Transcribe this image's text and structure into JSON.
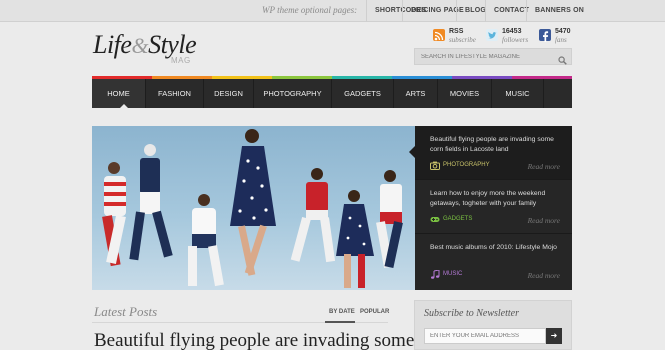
{
  "topbar": {
    "tagline": "WP theme optional pages:",
    "links": [
      "SHORTCODES",
      "PRICING PAGE",
      "BLOG",
      "CONTACT",
      "BANNERS ON"
    ]
  },
  "logo": {
    "line1": "Life",
    "amp": "&",
    "line2": "Style",
    "sub": "MAG"
  },
  "social": [
    {
      "icon": "rss-icon",
      "count": "RSS",
      "label": "subscribe",
      "color": "#f08a24"
    },
    {
      "icon": "twitter-icon",
      "count": "16453",
      "label": "followers",
      "color": "#5bb4dc"
    },
    {
      "icon": "facebook-icon",
      "count": "5470",
      "label": "fans",
      "color": "#3b5998"
    }
  ],
  "search": {
    "placeholder": "SEARCH IN LIFESTYLE MAGAZINE"
  },
  "nav": {
    "items": [
      "HOME",
      "FASHION",
      "DESIGN",
      "PHOTOGRAPHY",
      "GADGETS",
      "ARTS",
      "MOVIES",
      "MUSIC"
    ],
    "active": "HOME",
    "stripe_colors": [
      "#e22b2b",
      "#f08a24",
      "#f2c21b",
      "#8cc63f",
      "#29b6a8",
      "#2b8fd6",
      "#7a4cc2",
      "#c42b8a"
    ]
  },
  "features": [
    {
      "title": "Beautiful flying people are invading some corn fields in Lacoste land",
      "category": "PHOTOGRAPHY",
      "icon": "camera-icon",
      "more": "Read more"
    },
    {
      "title": "Learn how to enjoy more the weekend getaways, togheter with your family",
      "category": "GADGETS",
      "icon": "gamepad-icon",
      "more": "Read more"
    },
    {
      "title": "Best music albums of 2010: Lifestyle Mojo",
      "category": "MUSIC",
      "icon": "music-note-icon",
      "more": "Read more"
    }
  ],
  "latest": {
    "heading": "Latest Posts",
    "tabs": [
      "BY DATE",
      "POPULAR"
    ],
    "post_title": "Beautiful flying people are invading some"
  },
  "newsletter": {
    "heading": "Subscribe to Newsletter",
    "placeholder": "ENTER YOUR EMAIL ADDRESS",
    "button": "➜"
  }
}
